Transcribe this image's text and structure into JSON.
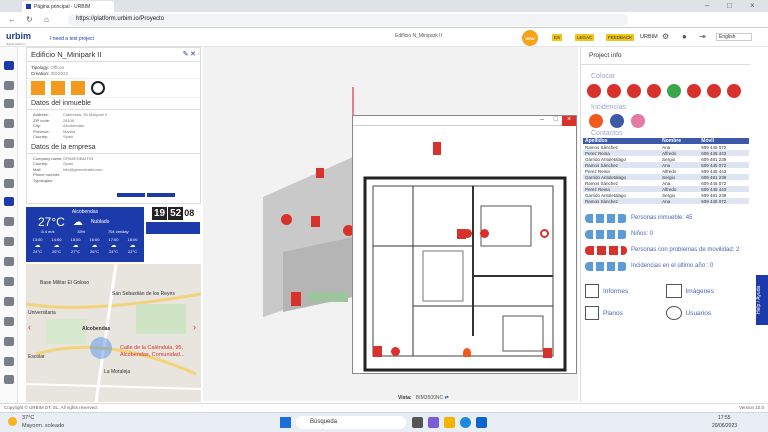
{
  "browser": {
    "tab_title": "Página principal - URBIM",
    "url": "https://platform.urbim.io/Proyecto"
  },
  "header": {
    "logo": "urbim",
    "logo_sub": "digital platform",
    "need_test": "I need a test project",
    "project_name": "Edificio N_Minipark II",
    "badge_new": "NEW",
    "lang1": "ES",
    "lang2": "LEGAC",
    "feedback": "FEEDBACK",
    "user": "URBIM",
    "language": "English"
  },
  "building": {
    "title": "Edificio N_Minipark II",
    "typology_label": "Tipology:",
    "typology": "Offices",
    "creation_label": "Creation:",
    "creation": "3/8/2023",
    "datos_inmueble": "Datos del inmueble",
    "fields": [
      {
        "k": "Address:",
        "v": "Calendula, 95 Minipark II"
      },
      {
        "k": "ZIP code:",
        "v": "28109"
      },
      {
        "k": "City:",
        "v": "Alcobendas"
      },
      {
        "k": "Province:",
        "v": "Madrid"
      },
      {
        "k": "Country:",
        "v": "Spain"
      }
    ],
    "datos_empresa": "Datos de la empresa",
    "company": [
      {
        "k": "Company name:",
        "v": "GRIMES/BAIT03"
      },
      {
        "k": "Country:",
        "v": "Spain"
      },
      {
        "k": "Mail:",
        "v": "info@grimesbaits.com"
      },
      {
        "k": "Phone number:",
        "v": ""
      },
      {
        "k": "Typologies:",
        "v": ""
      }
    ]
  },
  "weather": {
    "city": "Alcobendas",
    "temp": "27°C",
    "condition": "Nublado",
    "wind": "8.4 m/s",
    "humidity": "33%",
    "desc": "704 cm/day",
    "hours": [
      "13:00",
      "14:00",
      "15:00",
      "16:00",
      "17:00",
      "18:00"
    ],
    "temps": [
      "24°C",
      "26°C",
      "27°C",
      "26°C",
      "24°C",
      "22°C"
    ]
  },
  "clock": {
    "h": "19",
    "m": "52",
    "s": "08"
  },
  "map": {
    "labels": [
      "Base Militar El Goloso",
      "San Sebastián de los Reyes",
      "Universitaria",
      "Alcobendas",
      "La Moraleja",
      "Escolar"
    ],
    "address": "Calle de la Caléndula, 95, Alcobendas, Comunidad..."
  },
  "view": {
    "label": "Vista:",
    "value": "BIM3500NC"
  },
  "info": {
    "title": "Project info",
    "colocar": "Colocar",
    "incidencias": "Incidencias",
    "contactos": "Contactos",
    "table_headers": [
      "Apellidos",
      "Nombre",
      "Móvil"
    ],
    "rows": [
      [
        "Ramos Sánchez",
        "Ana",
        "609 445 072"
      ],
      [
        "Perez Reina",
        "Alfredo",
        "609 445 443"
      ],
      [
        "Garrido Antoletalago",
        "Sergio",
        "609 481 239"
      ],
      [
        "Ramos Sánchez",
        "Ana",
        "609 445 072"
      ],
      [
        "Perez Reina",
        "Alfredo",
        "609 445 443"
      ],
      [
        "Garrido Antoletalago",
        "Sergio",
        "609 481 239"
      ],
      [
        "Ramos Sánchez",
        "Ana",
        "609 445 072"
      ],
      [
        "Perez Reina",
        "Alfredo",
        "609 445 443"
      ],
      [
        "Garrido Antoletalago",
        "Sergio",
        "609 481 239"
      ],
      [
        "Ramos Sánchez",
        "Ana",
        "609 445 072"
      ]
    ],
    "stats": [
      "Personas inmueble: 45",
      "Niños: 0",
      "Personas con problemas de movilidad: 2",
      "Incidencias en el último año : 0"
    ],
    "links": [
      "Informes",
      "Imágenes",
      "Planos",
      "Usuarios"
    ]
  },
  "footer": {
    "copyright": "Copyright © URBIM DT, SL. All rights reserved.",
    "version": "Version 10.0"
  },
  "taskbar": {
    "temp": "37°C",
    "weather": "Mayorm. soleado",
    "search": "Búsqueda",
    "time": "17:55",
    "date": "20/06/2023"
  },
  "help": "Help / Ayuda",
  "colors": {
    "accent": "#1c3aa9",
    "red": "#d9312b",
    "blue": "#3d5aa8"
  }
}
